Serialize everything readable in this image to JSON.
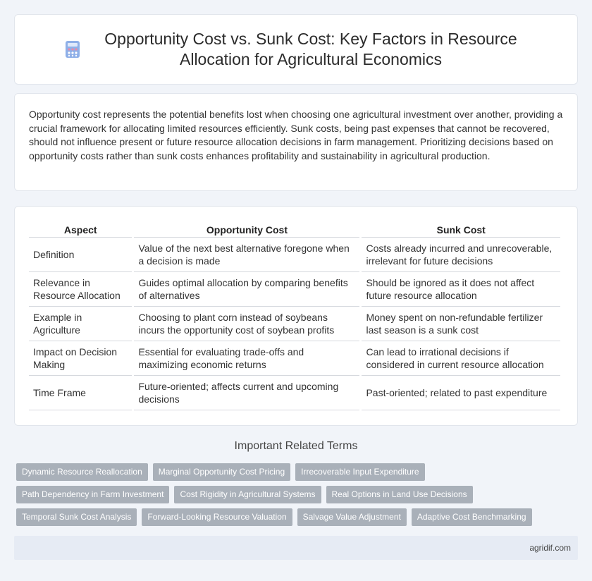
{
  "header": {
    "icon": "calculator-icon",
    "title": "Opportunity Cost vs. Sunk Cost: Key Factors in Resource Allocation for Agricultural Economics"
  },
  "intro": {
    "text": "Opportunity cost represents the potential benefits lost when choosing one agricultural investment over another, providing a crucial framework for allocating limited resources efficiently. Sunk costs, being past expenses that cannot be recovered, should not influence present or future resource allocation decisions in farm management. Prioritizing decisions based on opportunity costs rather than sunk costs enhances profitability and sustainability in agricultural production."
  },
  "table": {
    "headers": [
      "Aspect",
      "Opportunity Cost",
      "Sunk Cost"
    ],
    "rows": [
      [
        "Definition",
        "Value of the next best alternative foregone when a decision is made",
        "Costs already incurred and unrecoverable, irrelevant for future decisions"
      ],
      [
        "Relevance in Resource Allocation",
        "Guides optimal allocation by comparing benefits of alternatives",
        "Should be ignored as it does not affect future resource allocation"
      ],
      [
        "Example in Agriculture",
        "Choosing to plant corn instead of soybeans incurs the opportunity cost of soybean profits",
        "Money spent on non-refundable fertilizer last season is a sunk cost"
      ],
      [
        "Impact on Decision Making",
        "Essential for evaluating trade-offs and maximizing economic returns",
        "Can lead to irrational decisions if considered in current resource allocation"
      ],
      [
        "Time Frame",
        "Future-oriented; affects current and upcoming decisions",
        "Past-oriented; related to past expenditure"
      ]
    ]
  },
  "related": {
    "heading": "Important Related Terms",
    "rows": [
      [
        "Dynamic Resource Reallocation",
        "Marginal Opportunity Cost Pricing",
        "Irrecoverable Input Expenditure"
      ],
      [
        "Path Dependency in Farm Investment",
        "Cost Rigidity in Agricultural Systems",
        "Real Options in Land Use Decisions"
      ],
      [
        "Temporal Sunk Cost Analysis",
        "Forward-Looking Resource Valuation",
        "Salvage Value Adjustment",
        "Adaptive Cost Benchmarking"
      ]
    ]
  },
  "footer": {
    "site": "agridif.com"
  },
  "colors": {
    "background": "#f1f4f9",
    "tag": "#a9b0b9",
    "footer": "#e6ebf4"
  }
}
